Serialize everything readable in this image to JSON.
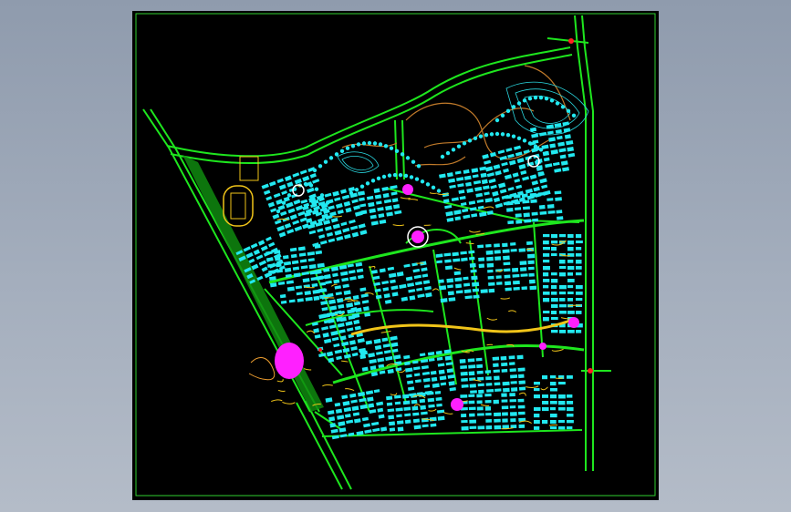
{
  "viewport": {
    "background": "#000000",
    "border_color": "#2fd12f"
  },
  "colors": {
    "roads": "#1ee61e",
    "road_median": "#0fa80f",
    "buildings": "#22e8f0",
    "building_edge": "#0aa8b0",
    "landscape": "#f0c419",
    "paths": "#c07a2a",
    "water_contours": "#2ad8e0",
    "plazas": "#ff20ff",
    "accents": "#ff2020",
    "white": "#ffffff"
  },
  "legend_title": ""
}
